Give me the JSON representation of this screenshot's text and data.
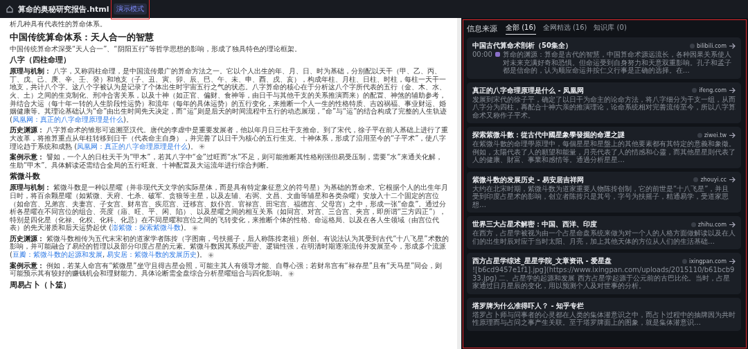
{
  "window": {
    "title": "算命的奥秘研究报告.html",
    "badge": "演示模式"
  },
  "document": {
    "blocks": [
      {
        "kind": "p",
        "cite": false,
        "parts": [
          {
            "kind": "text",
            "text": "析几种具有代表性的算命体系。"
          }
        ]
      },
      {
        "kind": "h2",
        "text": "中国传统算命体系：天人合一的智慧"
      },
      {
        "kind": "p",
        "cite": false,
        "parts": [
          {
            "kind": "text",
            "text": "中国传统算命术深受“天人合一”、“阴阳五行”等哲学思想的影响，形成了独具特色的理论框架。"
          }
        ]
      },
      {
        "kind": "h3",
        "text": "八字（四柱命理）"
      },
      {
        "kind": "p",
        "cite": false,
        "parts": [
          {
            "kind": "text",
            "text": "**原理与机制：** 八字，又称四柱命理，是中国流传最广的算命方法之一。它以个人出生的年、月、日、时为基础，分别配以天干（甲、乙、丙、丁、戊、己、庚、辛、壬、癸）和地支（子、丑、寅、卯、辰、巳、午、未、申、酉、戌、亥），构成年柱、月柱、日柱、时柱，每柱一天干一地支，共计八个字。这八个字被认为是记录了个体出生时宇宙五行之气的状态。八字算命的核心在于分析这八个字所代表的五行（金、木、水、火、土）之间的生克制化、刑冲合害关系，以及十神（如正官、偏财、食神等，由日干与其他干支的关系推演而来）的配置、神煞的辅助参考，并结合大运（每十年一转的人生阶段性运势）和流年（每年的具体运势）的五行变化，来推断一个人一生的性格特质、吉凶祸福、事业财运、婚姻健康等。其理论基础认为“命”由出生时间先天决定，而“运”则是后天的时间流程中五行的动态展现，“命”与“运”的结合构成了完整的人生轨迹 ("
          },
          {
            "kind": "link",
            "text": "凤凰网：真正的八字命理原理是什么"
          },
          {
            "kind": "text",
            "text": ")。"
          }
        ]
      },
      {
        "kind": "p",
        "cite": true,
        "parts": [
          {
            "kind": "text",
            "text": "**历史渊源：** 八字算命术的雏形可追溯至汉代。唐代的李虚中是重要发展者，他以年月日三柱干支推命。到了宋代，徐子平在前人基础上进行了重大改革，将推算重点从年柱转移到日干（代表命主自身），并完善了以日干为核心的五行生克、十神体系，形成了沿用至今的“子平术”，使八字理论趋于系统和成熟 ("
          },
          {
            "kind": "link",
            "text": "凤凰网：真正的八字命理原理是什么"
          },
          {
            "kind": "text",
            "text": ")。"
          }
        ]
      },
      {
        "kind": "p",
        "cite": false,
        "parts": [
          {
            "kind": "text",
            "text": "**案例示意：** 譬如，一个人的日柱天干为“甲木”，若其八字中“金”过旺而“水”不足，则可能推断其性格刚强但易受压制，需要“水”来通关化解，生助“甲木”。具体解读还需结合全局的五行旺衰、十神配置及大运流年进行综合判断。"
          }
        ]
      },
      {
        "kind": "h3",
        "text": "紫微斗数"
      },
      {
        "kind": "p",
        "cite": true,
        "parts": [
          {
            "kind": "text",
            "text": "**原理与机制：** 紫微斗数是一种以星曜（并非现代天文学的实际星体，而是具有特定象征意义的符号星）为基础的算命术。它根据个人的出生年月日时，将百余颗星曜（如紫微、天府、七杀、破军、贪狼等主星，以及左辅、右弼、文昌、文曲等辅星和各类杂曜）安放入十二个固定的宫位（如命宫、兄弟宫、夫妻宫、子女宫、财帛宫、疾厄宫、迁移宫、奴仆宫、官禄宫、田宅宫、福德宫、父母宫）之中，形成一张“命盘”。通过分析各星曜在不同宫位的组合、亮度（庙、旺、平、闲、陷）、以及星曜之间的相互关系（如同宫、对宫、三合宫、夹宫，即所谓“三方四正”），特别是四化星（化禄、化权、化科、化忌）在不同星曜和宫位之间的飞转变化，来推断个体的性格、命运格局、以及在各人生领域（由宫位代表）的先天潜质和后天运势起伏 ("
          },
          {
            "kind": "link",
            "text": "澎紫微：探索紫微斗数"
          },
          {
            "kind": "text",
            "text": ")。"
          }
        ]
      },
      {
        "kind": "p",
        "cite": true,
        "parts": [
          {
            "kind": "text",
            "text": "**历史渊源：** 紫微斗数相传为五代末宋初的道家学者陈抟（字图南，号扶摇子，后人称陈抟老祖）所创。有说法认为其受到古代“十八飞星”术数的影响，并可能融合了易经的哲理以及部分印度占星的元素。紫微斗数因其系统严密、逻辑性强，在明清时期逐渐流传并发展至今，形成多个流派 ("
          },
          {
            "kind": "link",
            "text": "豆瓣：紫微斗数的起源和发展"
          },
          {
            "kind": "text",
            "text": ", "
          },
          {
            "kind": "link",
            "text": "易安居：紫微斗数的发展历史"
          },
          {
            "kind": "text",
            "text": ")。"
          }
        ]
      },
      {
        "kind": "p",
        "cite": true,
        "parts": [
          {
            "kind": "text",
            "text": "**案例示意：** 例如，若某人命宫有“紫微星”坐守且得吉星会照，可能主其人有领导才能、自尊心强；若财帛宫有“禄存星”且有“天马星”同会，则可能预示其有较好的赚钱机会和理财能力。具体论断需全盘综合分析星曜组合与四化影响。"
          }
        ]
      },
      {
        "kind": "h3",
        "text": "周易占卜（卜筮）"
      }
    ]
  },
  "sources": {
    "title": "信息来源",
    "tabs": [
      {
        "label": "全部 (16)",
        "selected": true
      },
      {
        "label": "全网精选 (16)",
        "selected": false
      },
      {
        "label": "知识库 (0)",
        "selected": false
      }
    ],
    "cards": [
      {
        "title": "中国古代算命术剖析（50集全）",
        "time": "00:00",
        "desc": "算命的渊源：算命是古代的智慧，中国算命术源远流长，各种因果关系使人对未来充满好奇和恐惧。但命运受到自身努力和天意双重影响。孔子和孟子都是信命的，认为顺应命运并按仁义行事是正确的选择。在…",
        "source": "bilibili.com"
      },
      {
        "title": "真正的八字命理原理是什么 - 凤凰网",
        "desc": "发展到宋代的徐子平，确定了以日干为命主的论命方法，将八字细分为干支一组，从而八字分为四柱，再配合十神六亲的推演理论，论命系统相对完善流传至今，所以八字算命术又称作子平术。",
        "source": "ifeng.com"
      },
      {
        "title": "探索紫微斗數：從古代中國星象學發掘的命運之謎",
        "desc": "在紫微斗數的命理學原理中，每個星星和星盤上的其他要素都有其特定的意義和象徵。例如，太陽代表了人的願望和能量，月亮代表了人的情感和心靈，而其他星星則代表了人的健康、財富、事業和感情等。通過分析星星…",
        "source": "ziwei.tw"
      },
      {
        "title": "紫微斗数的发展历史 - 易安居吉祥网",
        "desc": "大约在北宋时期，紫微斗数为道家重要人物陈抟创制，它的前世是“十八飞星”，并且受到印度占星术的影响，创立者陈抟只是其号，字号为扶摇子，精通易学，受道家思想…",
        "source": "zhouyi.cc"
      },
      {
        "title": "世界三大占星术解密：中国、西洋、印度",
        "desc": "在西方，占星学被视为由一个占星命盘系统来做为对一个人的人格方面做解读以及在人们的出生时辰对应于当时太阳、月亮，加上其他天体的方位从人们的生活基础…",
        "source": "zhihu.com"
      },
      {
        "title": "西方占星学综述_星星学院_文章资讯 - 爱星盘",
        "desc": "![b6cd9457e1f1].jpg](https://www.ixingpan.com/uploads/2015110/b61bcb933.jpg) 二、占星学的起源和发展 西方占星学起源于公元前的古巴比伦。当时，占星家通过日月星辰的变化，用以预测个人及对世事的分析。",
        "source": "ixingpan.com"
      },
      {
        "title": "塔罗牌为什么准得吓人？ - 知乎专栏",
        "desc": "塔罗占卜师与问事者的心灵都在人类的集体潜意识之中，而占卜过程中的抽牌因为共时性原理而与占问之事产生关联。至于塔罗牌面上的图象，就是集体潜意识…"
      }
    ]
  }
}
